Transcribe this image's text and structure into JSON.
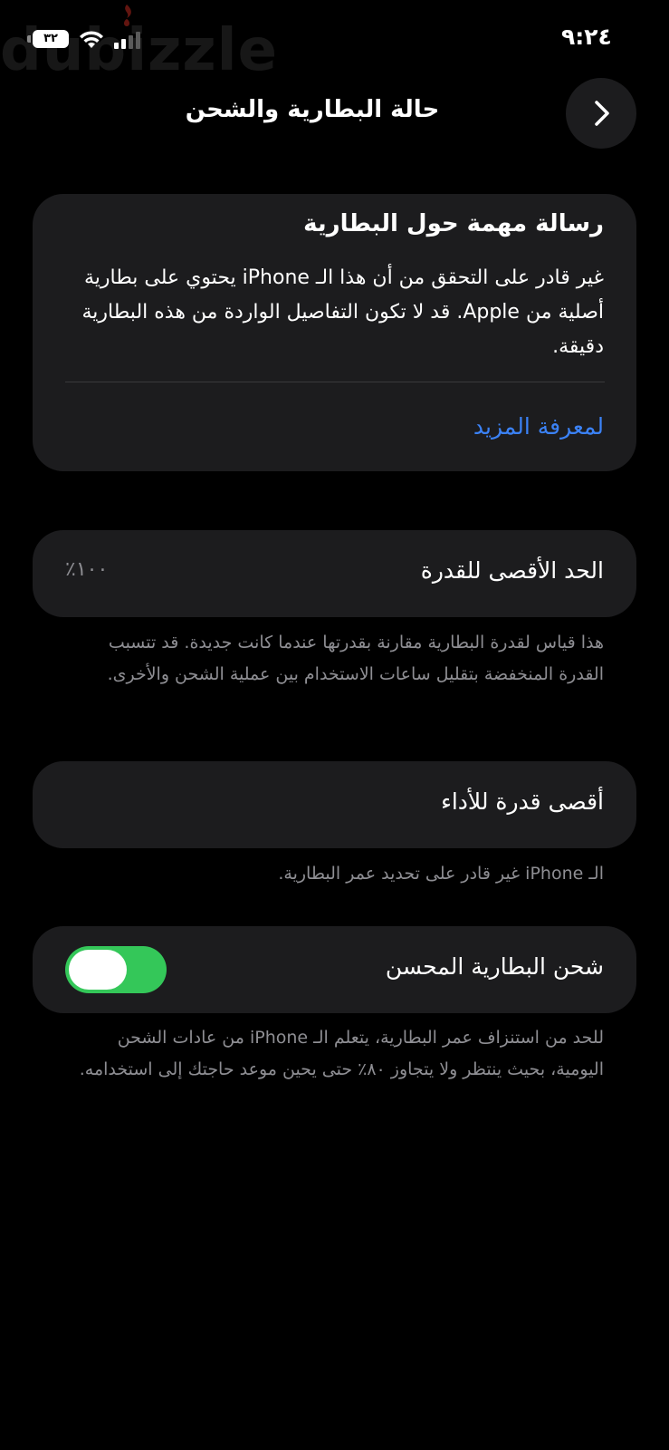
{
  "status_bar": {
    "time": "٩:٢٤",
    "battery_level": "٣٢",
    "watermark": "dubizzle",
    "wifi_icon": "wifi-icon",
    "signal_icon": "cellular-signal-icon"
  },
  "nav": {
    "title": "حالة البطارية والشحن",
    "back_icon": "chevron-icon"
  },
  "important_message": {
    "title": "رسالة مهمة حول البطارية",
    "body": "غير قادر على التحقق من أن هذا الـ iPhone يحتوي على بطارية أصلية من Apple. قد لا تكون التفاصيل الواردة من هذه البطارية دقيقة.",
    "link": "لمعرفة المزيد"
  },
  "max_capacity": {
    "label": "الحد الأقصى للقدرة",
    "value": "١٠٠٪",
    "footnote": "هذا قياس لقدرة البطارية مقارنة بقدرتها عندما كانت جديدة. قد تتسبب القدرة المنخفضة بتقليل ساعات الاستخدام بين عملية الشحن والأخرى."
  },
  "peak_performance": {
    "label": "أقصى قدرة للأداء",
    "footnote": "الـ iPhone غير قادر على تحديد عمر البطارية."
  },
  "optimized_charging": {
    "label": "شحن البطارية المحسن",
    "enabled": true,
    "footnote": "للحد من استنزاف عمر البطارية، يتعلم الـ iPhone من عادات الشحن اليومية، بحيث ينتظر ولا يتجاوز ٨٠٪ حتى يحين موعد حاجتك إلى استخدامه."
  },
  "colors": {
    "background": "#000000",
    "card": "#1c1c1e",
    "link": "#3b82f6",
    "toggle_on": "#34c759",
    "secondary_text": "#8e8e93"
  }
}
